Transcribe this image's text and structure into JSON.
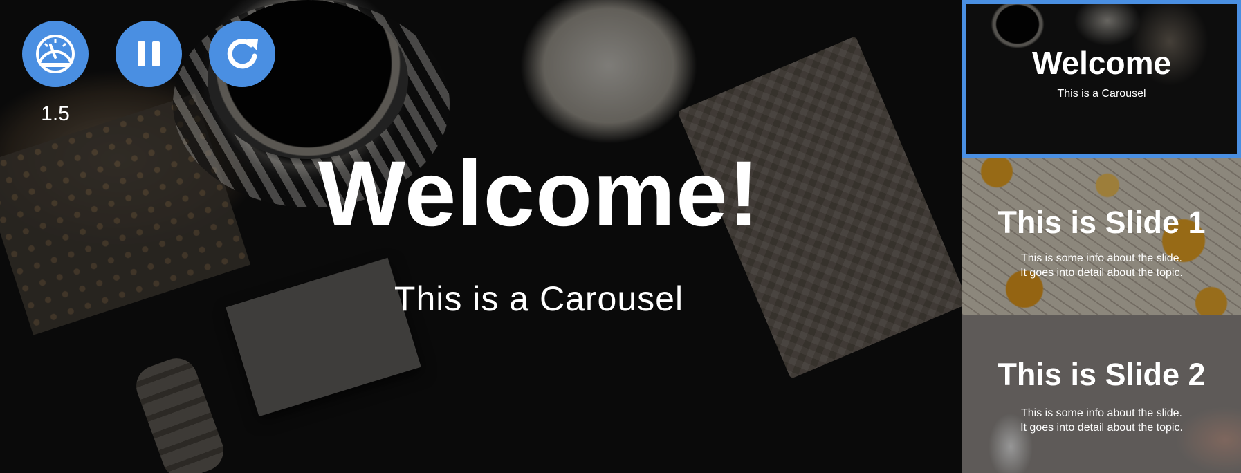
{
  "main_slide": {
    "title": "Welcome!",
    "subtitle": "This is a Carousel"
  },
  "controls": {
    "speed_value": "1.5",
    "buttons": [
      {
        "name": "speed",
        "icon": "speedometer-icon"
      },
      {
        "name": "pause",
        "icon": "pause-icon"
      },
      {
        "name": "restart",
        "icon": "reload-icon"
      }
    ],
    "accent_color": "#4a8fe2"
  },
  "thumbnails": [
    {
      "title": "Welcome",
      "line1": "This is a Carousel",
      "line2": "",
      "active": true
    },
    {
      "title": "This is Slide 1",
      "line1": "This is some info about the slide.",
      "line2": "It goes into detail about the topic.",
      "active": false
    },
    {
      "title": "This is Slide 2",
      "line1": "This is some info about the slide.",
      "line2": "It goes into detail about the topic.",
      "active": false
    }
  ]
}
